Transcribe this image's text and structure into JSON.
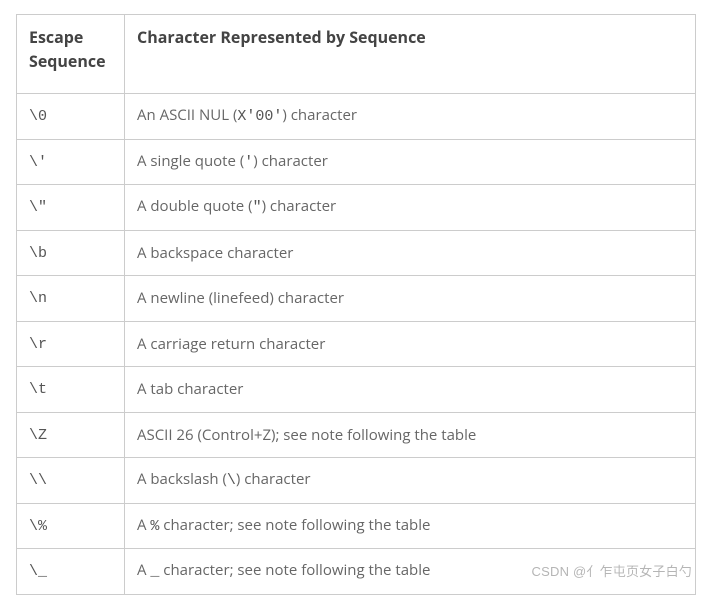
{
  "chart_data": {
    "type": "table",
    "title": "",
    "columns": [
      "Escape Sequence",
      "Character Represented by Sequence"
    ],
    "rows": [
      {
        "seq": "\\0",
        "desc_parts": [
          {
            "t": "An ASCII NUL ("
          },
          {
            "t": "X'00'",
            "mono": true
          },
          {
            "t": ") character"
          }
        ]
      },
      {
        "seq": "\\'",
        "desc_parts": [
          {
            "t": "A single quote ("
          },
          {
            "t": "'",
            "mono": true
          },
          {
            "t": ") character"
          }
        ]
      },
      {
        "seq": "\\\"",
        "desc_parts": [
          {
            "t": "A double quote ("
          },
          {
            "t": "\"",
            "mono": true
          },
          {
            "t": ") character"
          }
        ]
      },
      {
        "seq": "\\b",
        "desc_parts": [
          {
            "t": "A backspace character"
          }
        ]
      },
      {
        "seq": "\\n",
        "desc_parts": [
          {
            "t": "A newline (linefeed) character"
          }
        ]
      },
      {
        "seq": "\\r",
        "desc_parts": [
          {
            "t": "A carriage return character"
          }
        ]
      },
      {
        "seq": "\\t",
        "desc_parts": [
          {
            "t": "A tab character"
          }
        ]
      },
      {
        "seq": "\\Z",
        "desc_parts": [
          {
            "t": "ASCII 26 (Control+Z); see note following the table"
          }
        ]
      },
      {
        "seq": "\\\\",
        "desc_parts": [
          {
            "t": "A backslash ("
          },
          {
            "t": "\\",
            "mono": true
          },
          {
            "t": ") character"
          }
        ]
      },
      {
        "seq": "\\%",
        "desc_parts": [
          {
            "t": "A "
          },
          {
            "t": "%",
            "mono": true
          },
          {
            "t": " character; see note following the table"
          }
        ]
      },
      {
        "seq": "\\_",
        "desc_parts": [
          {
            "t": "A "
          },
          {
            "t": "_",
            "mono": true
          },
          {
            "t": " character; see note following the table"
          }
        ]
      }
    ]
  },
  "watermark": "CSDN @亻乍屯页女子白勺"
}
